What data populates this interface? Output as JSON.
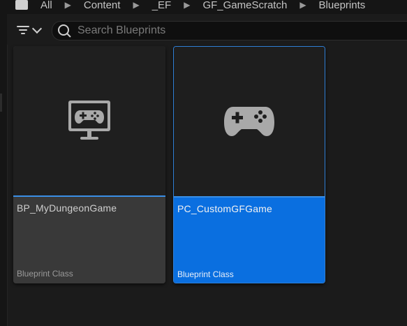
{
  "breadcrumb": {
    "items": [
      "All",
      "Content",
      "_EF",
      "GF_GameScratch",
      "Blueprints"
    ]
  },
  "toolbar": {
    "filter_icon": "filter-icon",
    "search": {
      "placeholder": "Search Blueprints",
      "value": ""
    }
  },
  "assets": [
    {
      "name": "BP_MyDungeonGame",
      "type": "Blueprint Class",
      "icon": "monitor-gamepad-icon",
      "selected": false
    },
    {
      "name": "PC_CustomGFGame",
      "type": "Blueprint Class",
      "icon": "gamepad-icon",
      "selected": true
    }
  ],
  "colors": {
    "selection": "#0a6fe0",
    "accent": "#3a8fe6",
    "background": "#1b1b1b"
  }
}
